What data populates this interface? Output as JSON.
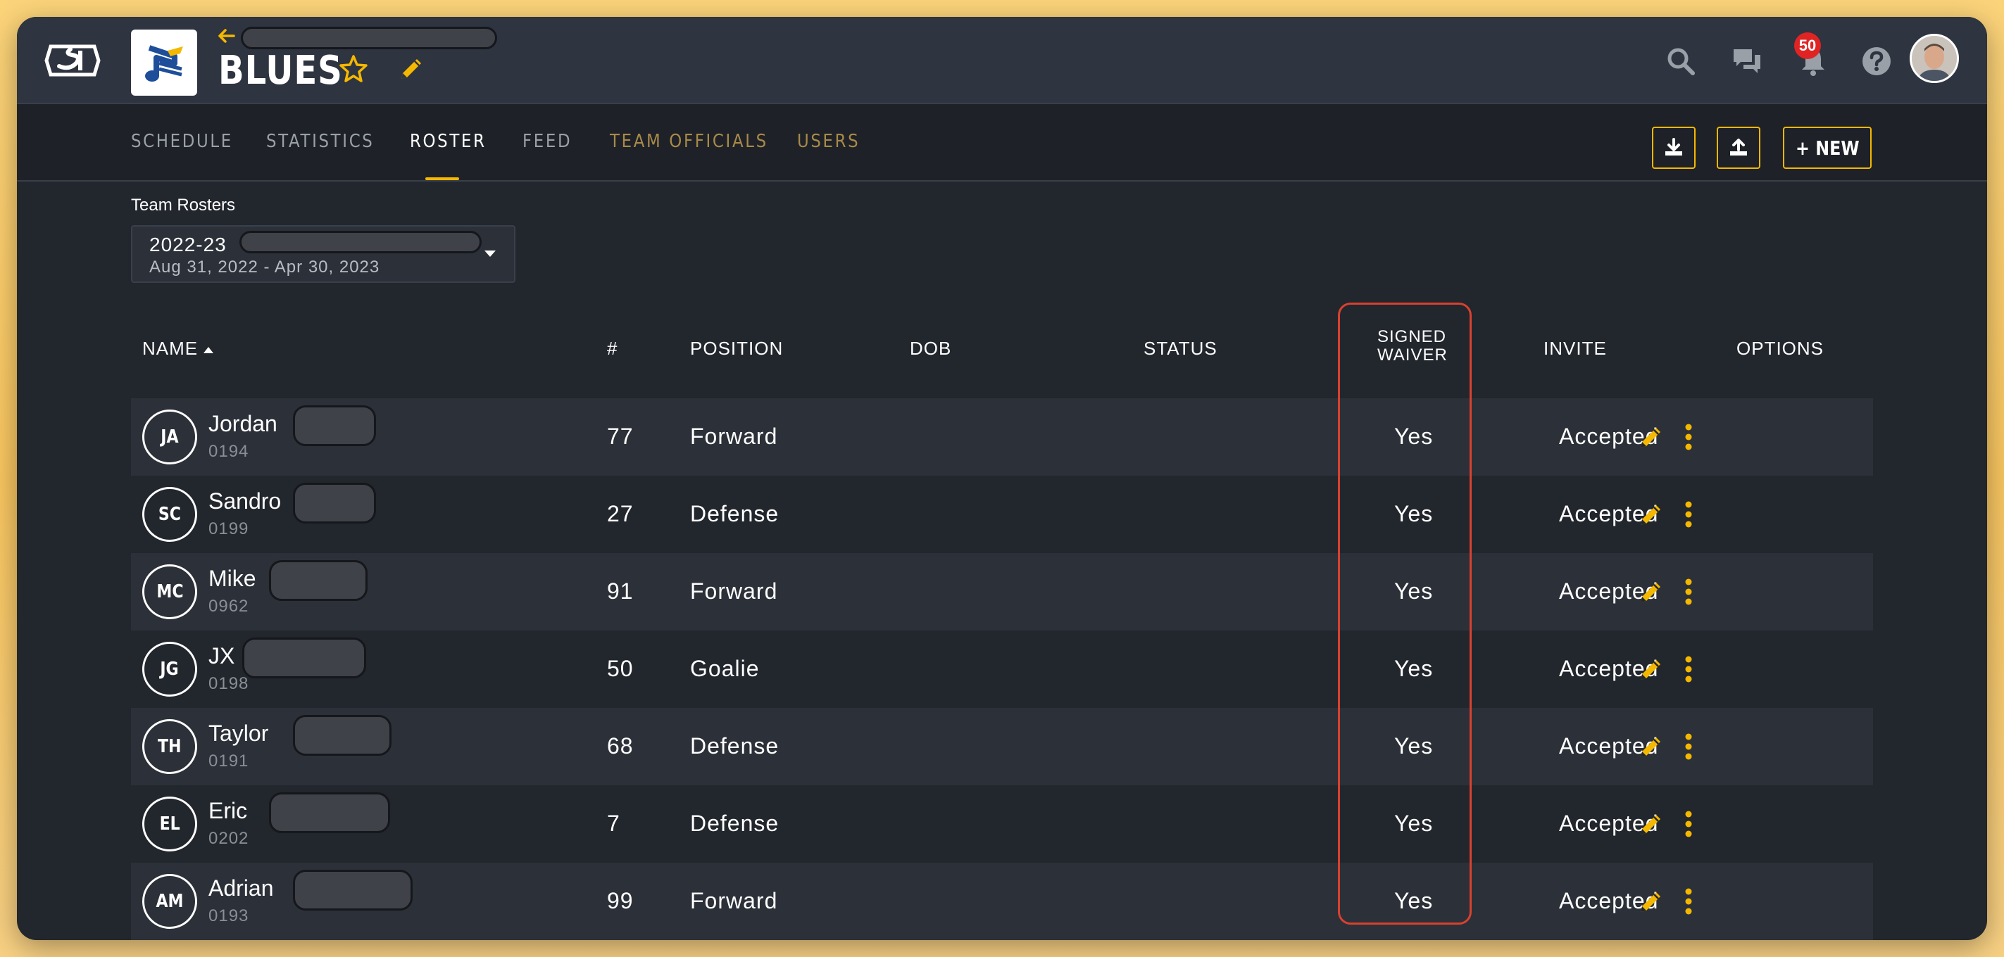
{
  "header": {
    "team_name": "BLUES",
    "notification_count": "50",
    "icons": [
      "search-icon",
      "chat-icon",
      "bell-icon",
      "help-icon"
    ]
  },
  "tabs": [
    {
      "label": "SCHEDULE",
      "state": "normal"
    },
    {
      "label": "STATISTICS",
      "state": "normal"
    },
    {
      "label": "ROSTER",
      "state": "active"
    },
    {
      "label": "FEED",
      "state": "normal"
    },
    {
      "label": "TEAM OFFICIALS",
      "state": "restricted"
    },
    {
      "label": "USERS",
      "state": "restricted"
    }
  ],
  "actions": {
    "download_icon": "download-icon",
    "upload_icon": "upload-icon",
    "new_label": "+ NEW"
  },
  "roster_select": {
    "label": "Team Rosters",
    "season": "2022-23",
    "dates": "Aug 31, 2022 - Apr 30, 2023"
  },
  "table": {
    "columns": {
      "name": "NAME",
      "number": "#",
      "position": "POSITION",
      "dob": "DOB",
      "status": "STATUS",
      "signed_waiver_1": "SIGNED",
      "signed_waiver_2": "WAIVER",
      "invite": "INVITE",
      "options": "OPTIONS"
    },
    "rows": [
      {
        "initials": "JA",
        "name": "Jordan",
        "id": "0194",
        "number": "77",
        "position": "Forward",
        "dob": "",
        "status": "",
        "waiver": "Yes",
        "invite": "Accepted"
      },
      {
        "initials": "SC",
        "name": "Sandro",
        "id": "0199",
        "number": "27",
        "position": "Defense",
        "dob": "",
        "status": "",
        "waiver": "Yes",
        "invite": "Accepted"
      },
      {
        "initials": "MC",
        "name": "Mike",
        "id": "0962",
        "number": "91",
        "position": "Forward",
        "dob": "",
        "status": "",
        "waiver": "Yes",
        "invite": "Accepted"
      },
      {
        "initials": "JG",
        "name": "JX",
        "id": "0198",
        "number": "50",
        "position": "Goalie",
        "dob": "",
        "status": "",
        "waiver": "Yes",
        "invite": "Accepted"
      },
      {
        "initials": "TH",
        "name": "Taylor",
        "id": "0191",
        "number": "68",
        "position": "Defense",
        "dob": "",
        "status": "",
        "waiver": "Yes",
        "invite": "Accepted"
      },
      {
        "initials": "EL",
        "name": "Eric",
        "id": "0202",
        "number": "7",
        "position": "Defense",
        "dob": "",
        "status": "",
        "waiver": "Yes",
        "invite": "Accepted"
      },
      {
        "initials": "AM",
        "name": "Adrian",
        "id": "0193",
        "number": "99",
        "position": "Forward",
        "dob": "",
        "status": "",
        "waiver": "Yes",
        "invite": "Accepted"
      }
    ]
  },
  "colors": {
    "accent": "#f5b800",
    "highlight": "#d8412f",
    "background": "#22262d",
    "header": "#2e3440"
  }
}
